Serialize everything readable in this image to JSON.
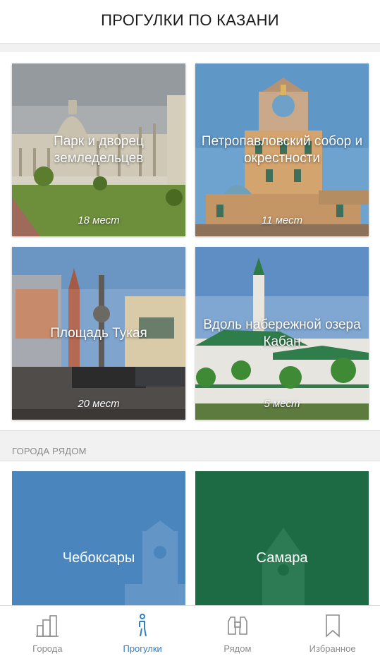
{
  "header": {
    "title": "ПРОГУЛКИ ПО КАЗАНИ"
  },
  "walks": [
    {
      "title": "Парк и дворец земледельцев",
      "count": "18 мест",
      "image": "palace-of-farmers-photo"
    },
    {
      "title": "Петропавловский собор и окрестности",
      "count": "11 мест",
      "image": "peter-and-paul-cathedral-photo"
    },
    {
      "title": "Площадь Тукая",
      "count": "20 мест",
      "image": "tukay-square-photo"
    },
    {
      "title": "Вдоль набережной озера Кабан",
      "count": "5 мест",
      "image": "lake-kaban-mosque-photo"
    }
  ],
  "nearby": {
    "title": "ГОРОДА РЯДОМ",
    "cities": [
      {
        "name": "Чебоксары",
        "color": "#4a86bd"
      },
      {
        "name": "Самара",
        "color": "#1d6b45"
      }
    ]
  },
  "tabs": [
    {
      "label": "Города",
      "icon": "city-buildings-icon",
      "active": false
    },
    {
      "label": "Прогулки",
      "icon": "walking-person-icon",
      "active": true
    },
    {
      "label": "Рядом",
      "icon": "binoculars-icon",
      "active": false
    },
    {
      "label": "Избранное",
      "icon": "bookmark-icon",
      "active": false
    }
  ],
  "colors": {
    "accent": "#2f80c6",
    "inactive": "#8c8c8c"
  }
}
